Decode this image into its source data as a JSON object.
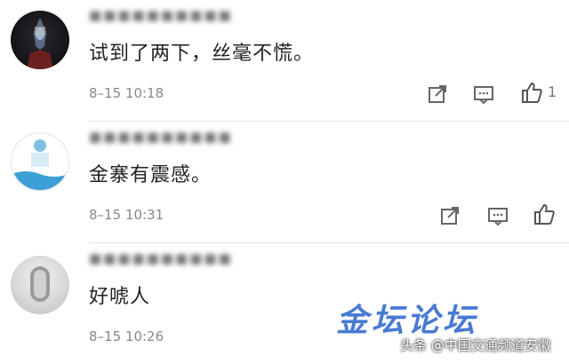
{
  "comments": [
    {
      "username": "■■■■■■■■■■",
      "content": "试到了两下，丝毫不慌。",
      "time": "8–15 10:18",
      "icons": [
        "share-icon",
        "comment-icon",
        "like-icon"
      ],
      "like_count": "1"
    },
    {
      "username": "■■■■■■■■■■",
      "content": "金寨有震感。",
      "time": "8–15 10:31",
      "icons": [
        "share-icon",
        "comment-icon",
        "like-icon"
      ]
    },
    {
      "username": "■■■■■■■■■■",
      "content": "好唬人",
      "time": "8–15 10:26"
    }
  ],
  "watermark": "金坛论坛",
  "credit": "头条 @中国交通频道安徽",
  "colors": {
    "watermark": "#3a6fd0",
    "text": "#222222",
    "meta": "#888888"
  }
}
